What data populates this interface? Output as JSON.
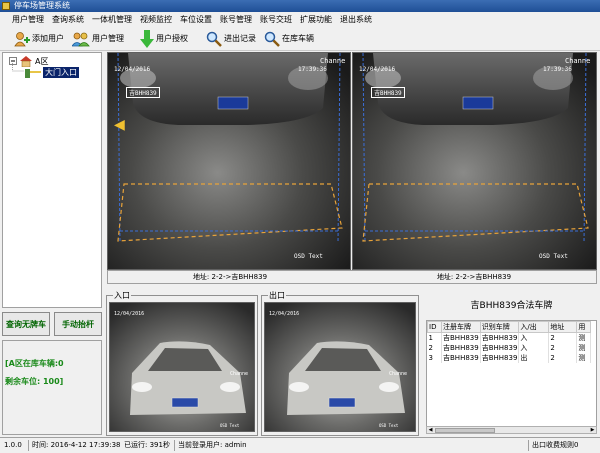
{
  "window": {
    "title": "停车场管理系统"
  },
  "menu": [
    "用户管理",
    "查询系统",
    "一体机管理",
    "视频监控",
    "车位设置",
    "账号管理",
    "账号交班",
    "扩展功能",
    "退出系统"
  ],
  "toolbar": {
    "add_user": "添加用户",
    "user_manage": "用户管理",
    "user_auth": "用户授权",
    "exit_record": "进出记录",
    "in_lot": "在库车辆"
  },
  "tree": {
    "root": "A区",
    "child": "大门入口"
  },
  "buttons": {
    "query_plate": "查询无牌车",
    "manual_lift": "手动抬杆"
  },
  "stats": {
    "in_lot_line": "[A区在库车辆:0",
    "remaining_line": "剩余车位: 100]"
  },
  "camera": {
    "date": "12/04/2016",
    "time": "17:39:36",
    "channel": "Channe",
    "plate": "吉BHH839",
    "osd": "OSD Text"
  },
  "address": {
    "left": "地址: 2-2->吉BHH839",
    "right": "地址: 2-2->吉BHH839"
  },
  "lanes": {
    "entry": "入口",
    "exit": "出口"
  },
  "plate_panel": {
    "title": "吉BHH839合法车牌"
  },
  "grid": {
    "columns": [
      "ID",
      "注册车牌",
      "识别车牌",
      "入/出",
      "地址",
      "用"
    ],
    "rows": [
      [
        "1",
        "吉BHH839",
        "吉BHH839",
        "入",
        "2",
        "测"
      ],
      [
        "2",
        "吉BHH839",
        "吉BHH839",
        "入",
        "2",
        "测"
      ],
      [
        "3",
        "吉BHH839",
        "吉BHH839",
        "出",
        "2",
        "测"
      ]
    ]
  },
  "status": {
    "version": "1.0.0",
    "time": "时间: 2016-4-12 17:39:38",
    "uptime": "已运行: 391秒",
    "user": "当前登录用户: admin",
    "rule": "出口收费规则0"
  },
  "icons": [
    "app-icon",
    "add-user-icon",
    "users-icon",
    "down-arrow-icon",
    "search-icon",
    "tree-collapse-icon",
    "house-icon",
    "gate-icon",
    "scroll-left-icon",
    "scroll-right-icon"
  ],
  "colors": {
    "titlebar": "#1f4f96",
    "stats_text": "#1a8a1a",
    "selection": "#0a246a",
    "zone_line": "#e8a33a",
    "zone_line_blue": "#3a6ed8"
  }
}
